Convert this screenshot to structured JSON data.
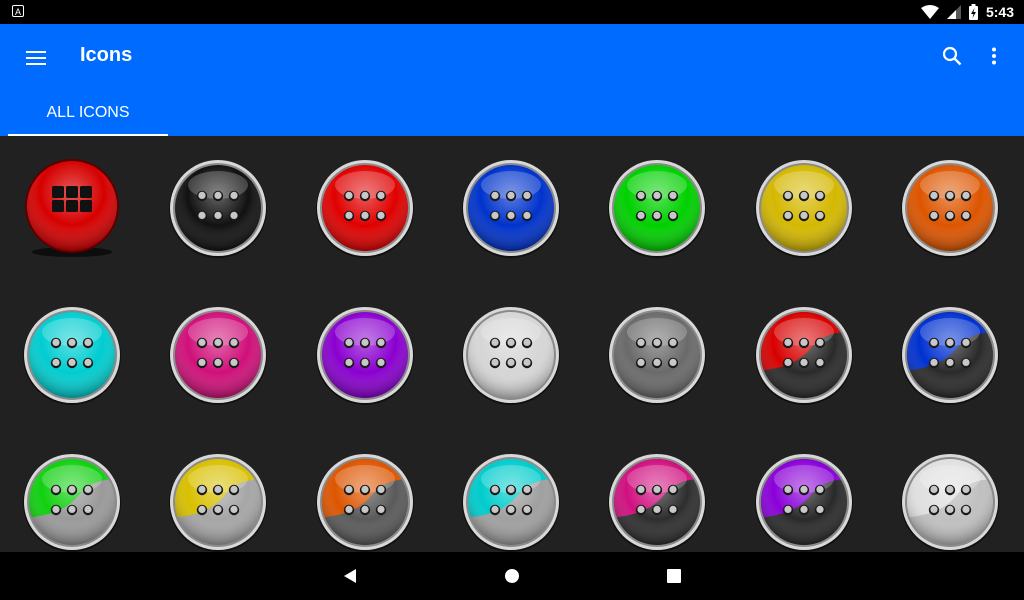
{
  "status_bar": {
    "time": "5:43",
    "left_icon": "A",
    "icons": [
      "wifi-icon",
      "signal-icon",
      "battery-charging-icon"
    ]
  },
  "app_bar": {
    "title": "Icons",
    "menu_icon": "menu-icon",
    "search_icon": "search-icon",
    "more_icon": "more-vertical-icon",
    "color": "#006cff"
  },
  "tabs": [
    {
      "label": "ALL ICONS",
      "active": true
    }
  ],
  "icons": [
    {
      "name": "red-apps",
      "style": "apps",
      "color": "#d60000"
    },
    {
      "name": "black",
      "style": "solid",
      "color": "#111111"
    },
    {
      "name": "red",
      "style": "solid",
      "color": "#e00000"
    },
    {
      "name": "blue",
      "style": "solid",
      "color": "#0033cc"
    },
    {
      "name": "green",
      "style": "solid",
      "color": "#00d000"
    },
    {
      "name": "yellow",
      "style": "solid",
      "color": "#d4b800"
    },
    {
      "name": "orange",
      "style": "solid",
      "color": "#dd5500"
    },
    {
      "name": "cyan",
      "style": "solid",
      "color": "#00cdd0"
    },
    {
      "name": "pink",
      "style": "solid",
      "color": "#d0107a"
    },
    {
      "name": "purple",
      "style": "solid",
      "color": "#8a00d0"
    },
    {
      "name": "white",
      "style": "solid",
      "color": "#d6d6d6"
    },
    {
      "name": "gray",
      "style": "solid",
      "color": "#6a6a6a"
    },
    {
      "name": "red-black",
      "style": "split",
      "color": "#d80000",
      "base": "#2a2a2a"
    },
    {
      "name": "blue-black",
      "style": "split",
      "color": "#0030d0",
      "base": "#2a2a2a"
    },
    {
      "name": "green-gray",
      "style": "split",
      "color": "#10d010",
      "base": "#9a9a9a"
    },
    {
      "name": "yellow-gray",
      "style": "split",
      "color": "#d8c000",
      "base": "#a6a6a6"
    },
    {
      "name": "orange-gray",
      "style": "split",
      "color": "#dd5500",
      "base": "#5a5a5a"
    },
    {
      "name": "cyan-gray",
      "style": "split",
      "color": "#00cccc",
      "base": "#a0a0a0"
    },
    {
      "name": "pink-black",
      "style": "split",
      "color": "#d01080",
      "base": "#2e2e2e"
    },
    {
      "name": "purple-black",
      "style": "split",
      "color": "#8a00d8",
      "base": "#2a2a2a"
    },
    {
      "name": "white-gray",
      "style": "split",
      "color": "#e0e0e0",
      "base": "#c0c0c0"
    }
  ],
  "nav_bar": {
    "back_icon": "back-icon",
    "home_icon": "home-icon",
    "recents_icon": "recents-icon"
  }
}
